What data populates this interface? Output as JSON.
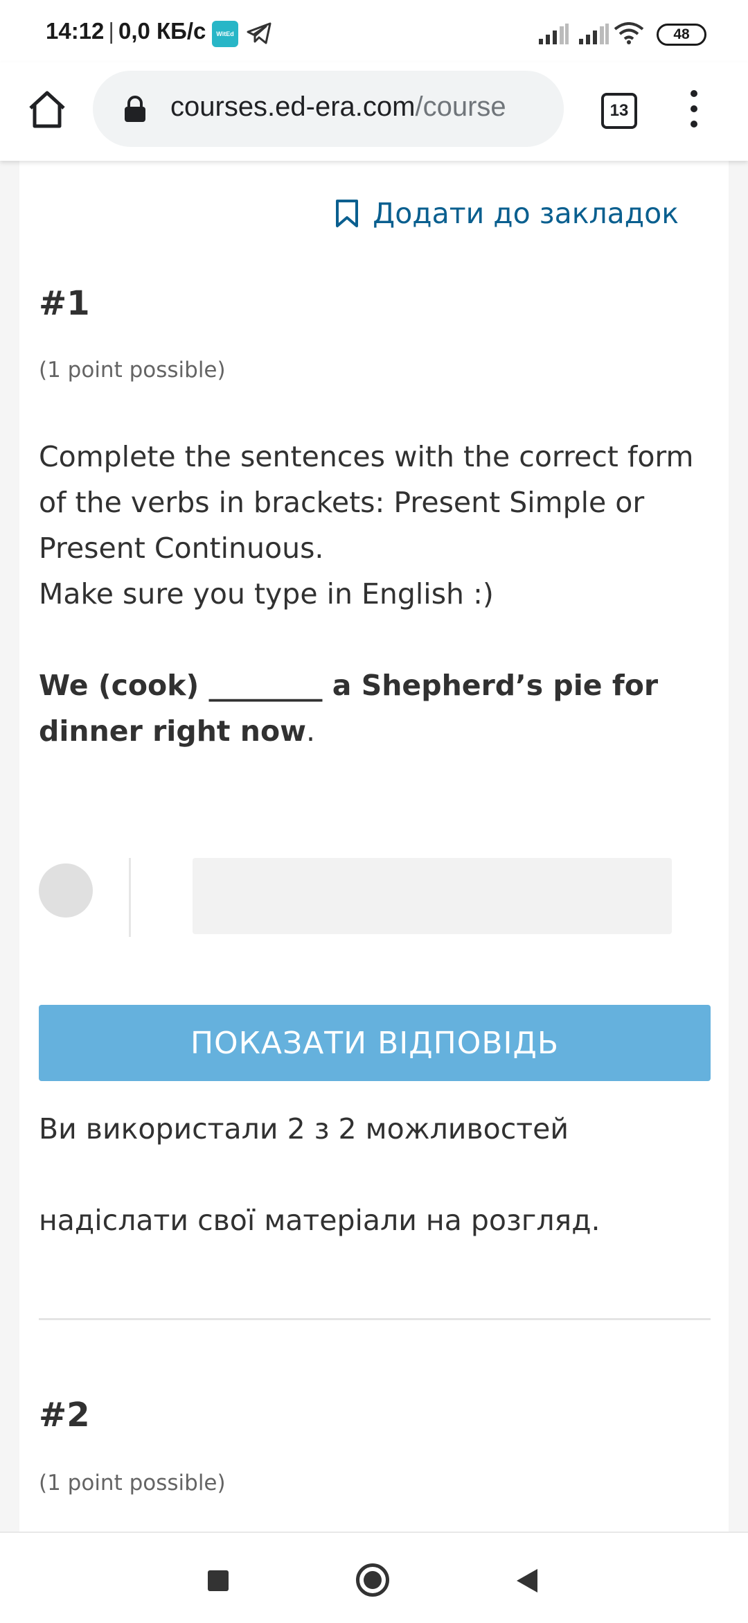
{
  "status_bar": {
    "time": "14:12",
    "separator": "|",
    "net_speed": "0,0 КБ/с",
    "app_badge": "WitEd",
    "battery": "48"
  },
  "browser": {
    "url_domain": "courses.ed-era.com",
    "url_path": "/course",
    "tab_count": "13"
  },
  "page": {
    "bookmark_label": "Додати до закладок",
    "problem1": {
      "title": "#1",
      "points": "(1 point possible)",
      "instruction": "Complete the sentences with the correct form of the verbs in brackets: Present Simple or Present Continuous.",
      "note": "Make sure you type in English :)",
      "sentence_bold": "We (cook) ________ a Shepherd’s pie for dinner right now",
      "sentence_end": ".",
      "answer_value": "",
      "show_answer_label": "ПОКАЗАТИ ВІДПОВІДЬ",
      "attempts_text": "Ви використали 2 з 2 можливостей",
      "submit_text": "надіслати свої матеріали на розгляд."
    },
    "problem2": {
      "title": "#2",
      "points": "(1 point possible)"
    }
  },
  "colors": {
    "button_bg": "#65b1dd",
    "link": "#0a5f8f",
    "text": "#313131"
  }
}
